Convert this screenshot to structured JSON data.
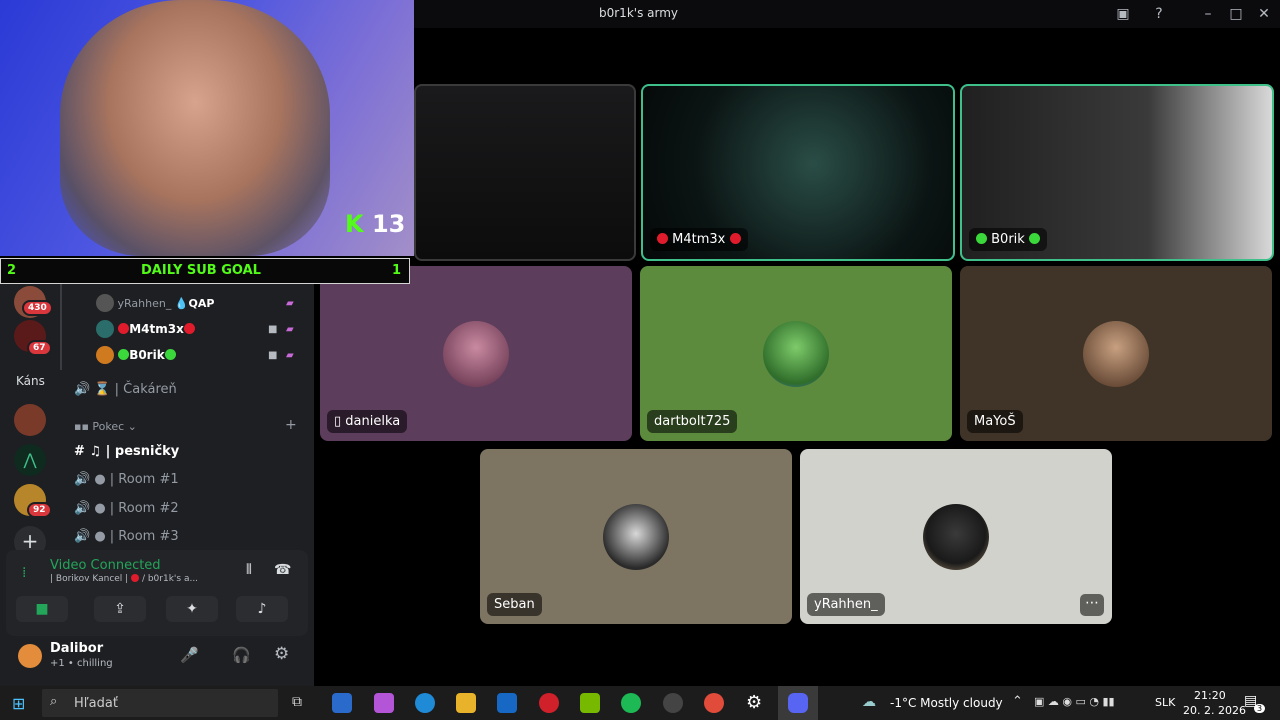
{
  "window": {
    "title": "b0r1k's army"
  },
  "stage": {
    "tiles": [
      {
        "name": "M4tm3x"
      },
      {
        "name": "B0rik"
      },
      {
        "name": "danielka"
      },
      {
        "name": "dartbolt725"
      },
      {
        "name": "MaYoŠ"
      },
      {
        "name": "Seban"
      },
      {
        "name": "yRahhen_"
      }
    ]
  },
  "overlay": {
    "kick_count": "13",
    "subgoal": {
      "left": "2",
      "label": "DAILY SUB GOAL",
      "right": "1"
    }
  },
  "guilds": {
    "badges": [
      "430",
      "67",
      "92"
    ],
    "folder_label": "Káns"
  },
  "channels": {
    "voice_users": [
      {
        "name": "yRahhen_",
        "tag": "QAP"
      },
      {
        "name": "M4tm3x"
      },
      {
        "name": "B0rik"
      }
    ],
    "waiting": "| Čakáreň",
    "category": "Pokec",
    "text_channel": "| pesničky",
    "rooms": [
      "| Room #1",
      "| Room #2",
      "| Room #3"
    ]
  },
  "voice": {
    "status": "Video Connected",
    "server": "| Borikov Kancel |",
    "channel": "b0r1k's a..."
  },
  "user": {
    "name": "Dalibor",
    "status": "+1 • chilling"
  },
  "taskbar": {
    "search_placeholder": "Hľadať",
    "weather": "-1°C  Mostly cloudy",
    "lang": "SLK",
    "time": "21:20",
    "date": "20. 2. 2026",
    "notif_count": "3"
  }
}
